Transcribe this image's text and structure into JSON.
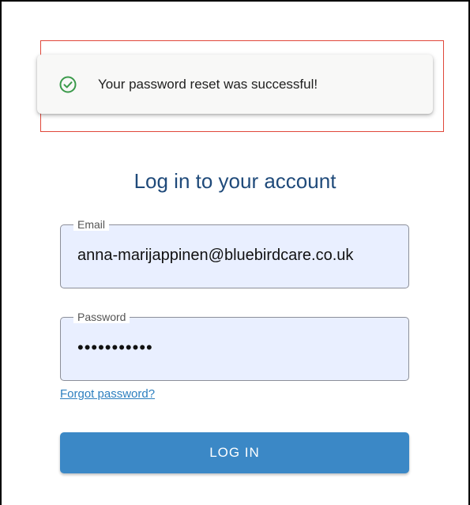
{
  "toast": {
    "message": "Your password reset was successful!",
    "icon": "check-circle-icon",
    "icon_color": "#3a9a4a"
  },
  "login": {
    "title": "Log in to your account",
    "email_label": "Email",
    "email_value": "anna-marijappinen@bluebirdcare.co.uk",
    "password_label": "Password",
    "password_value": "•••••••••••",
    "forgot_link": "Forgot password?",
    "submit_label": "LOG IN"
  },
  "colors": {
    "accent": "#3b88c6",
    "title": "#1f4a7a",
    "highlight": "#e0473a",
    "field_bg": "#e9efff"
  }
}
